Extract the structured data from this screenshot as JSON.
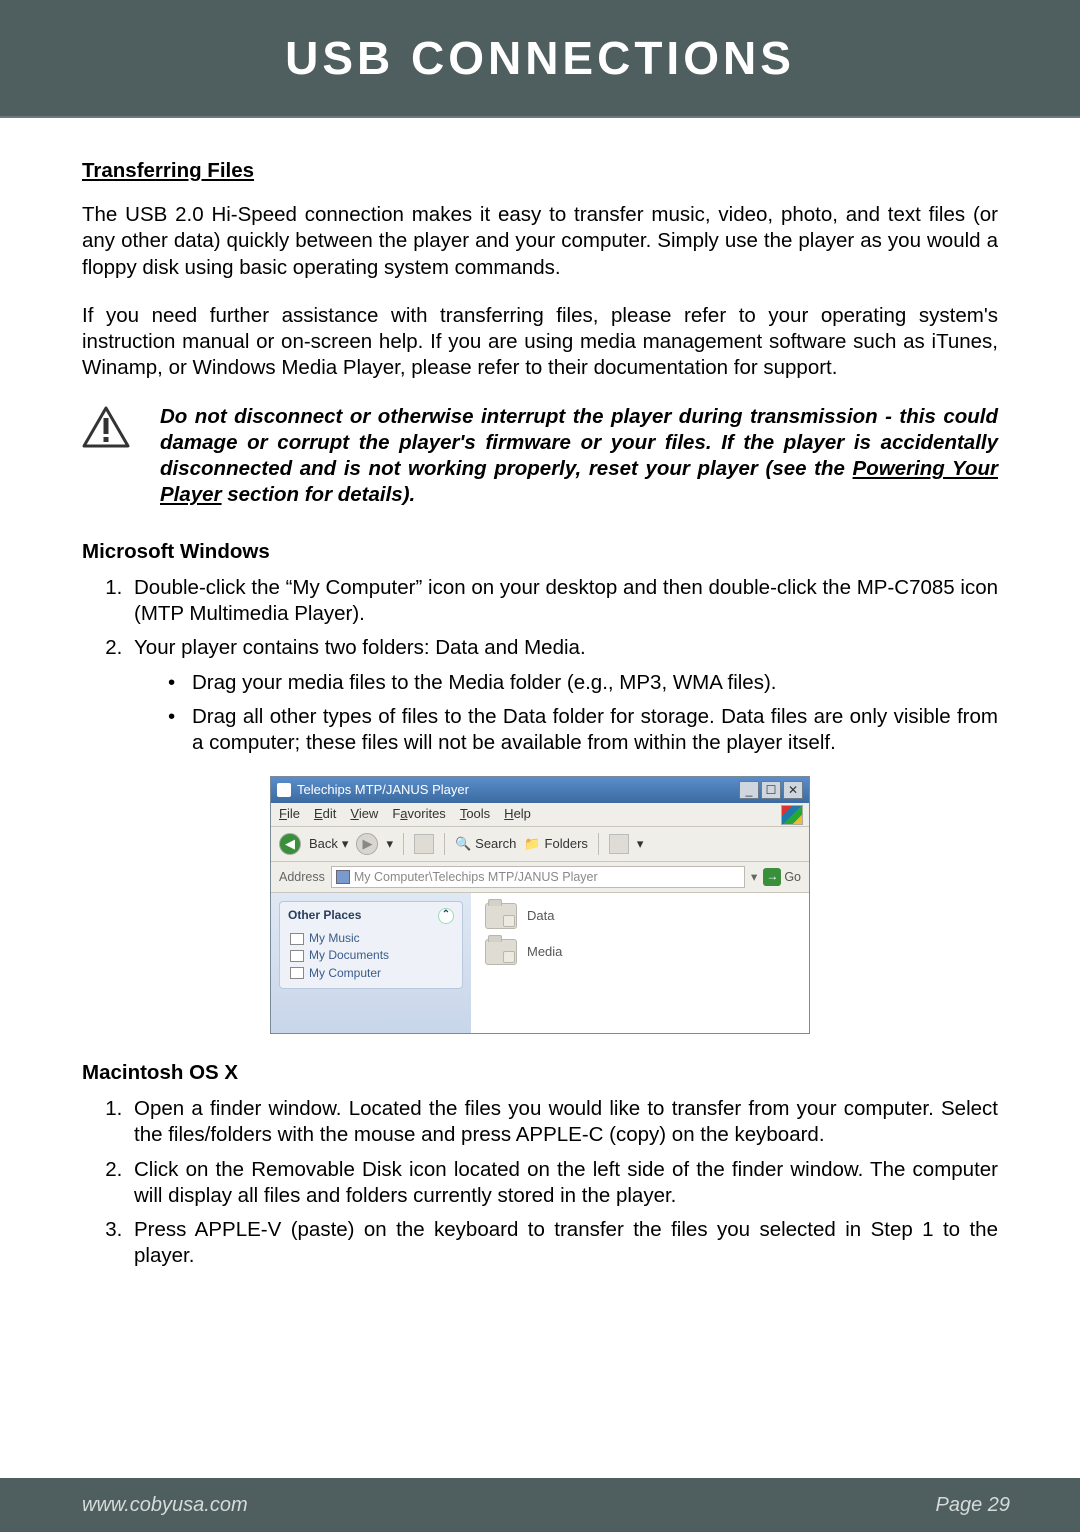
{
  "header": {
    "title": "USB Connections"
  },
  "section1": {
    "title": "Transferring Files",
    "p1": "The USB 2.0 Hi-Speed connection makes it easy to transfer music, video, photo, and text files (or any other data) quickly between the player and your computer. Simply use the player as you would a floppy disk using basic operating system commands.",
    "p2": "If you need further assistance with transferring files, please refer to your operating system's instruction manual or on-screen help. If you are using media management software such as iTunes, Winamp, or Windows Media Player, please refer to their documentation for support."
  },
  "warning": {
    "text_pre": "Do not disconnect or otherwise interrupt the player during transmission - this could damage or corrupt the player's firmware or your files. If the player is accidentally disconnected and is not working properly, reset your player (see the ",
    "link": "Powering Your Player",
    "text_post": " section for details)."
  },
  "windows": {
    "heading": "Microsoft Windows",
    "step1": "Double-click the “My Computer” icon on your desktop and then double-click the MP-C7085 icon (MTP Multimedia Player).",
    "step2": "Your player contains two folders: Data and Media.",
    "bullet1": "Drag your media files to the Media folder (e.g., MP3, WMA files).",
    "bullet2": "Drag all other types of files to the Data folder for storage. Data files are only visible from a computer; these files will not be available from within the player itself."
  },
  "mac": {
    "heading": "Macintosh OS X",
    "step1": "Open a finder window. Located the files you would like to transfer from your computer. Select the files/folders with the mouse and press APPLE-C (copy) on the keyboard.",
    "step2": "Click on the Removable Disk icon located on the left side of the finder window. The computer will display all files and folders currently stored in the player.",
    "step3": "Press APPLE-V (paste) on the keyboard to transfer the files you selected in Step 1 to the player."
  },
  "screenshot": {
    "title": "Telechips MTP/JANUS Player",
    "menus": {
      "file": "File",
      "edit": "Edit",
      "view": "View",
      "favorites": "Favorites",
      "tools": "Tools",
      "help": "Help"
    },
    "toolbar": {
      "back": "Back",
      "search": "Search",
      "folders": "Folders"
    },
    "address_label": "Address",
    "address_path": "My Computer\\Telechips MTP/JANUS Player",
    "go": "Go",
    "side_heading": "Other Places",
    "side_items": {
      "music": "My Music",
      "docs": "My Documents",
      "comp": "My Computer"
    },
    "folders_main": {
      "data": "Data",
      "media": "Media"
    }
  },
  "footer": {
    "url": "www.cobyusa.com",
    "page": "Page 29"
  }
}
